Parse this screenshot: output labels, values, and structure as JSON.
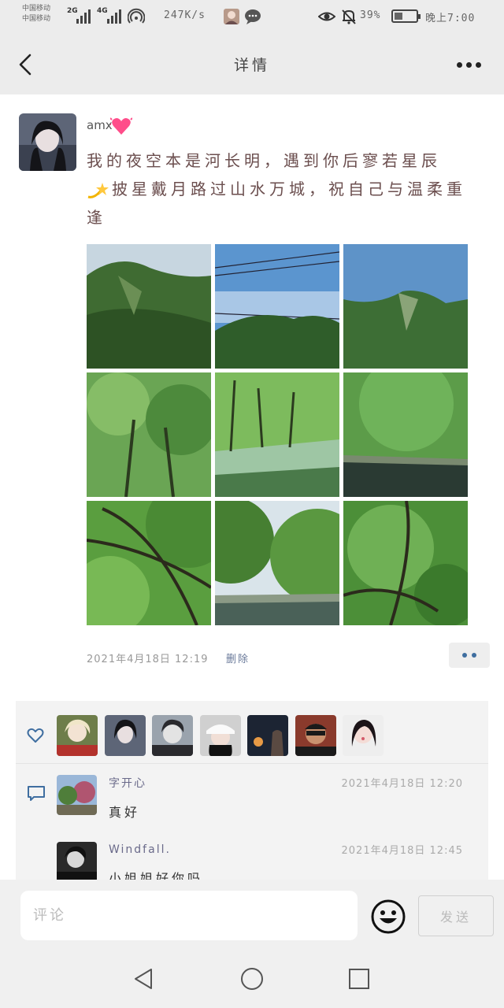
{
  "status_bar": {
    "carrier_1": "中国移动",
    "carrier_2": "中国移动",
    "network_1": "2G",
    "network_2": "4G",
    "speed": "247K/s",
    "battery": "39%",
    "battery_level": 0.39,
    "time": "晚上7:00"
  },
  "header": {
    "title": "详情"
  },
  "post": {
    "username": "amx",
    "text_line1": "我的夜空本是河长明，遇到你后寥若星辰",
    "text_line2": "披星戴月路过山水万城，祝自己与温柔重逢",
    "date": "2021年4月18日 12:19",
    "delete_label": "删除",
    "photos": [
      "mountain-slope",
      "power-lines-sky",
      "mountain-ridge",
      "green-trees",
      "river-trees",
      "lake-trees",
      "tree-canopy",
      "river-bank",
      "leafy-branches"
    ]
  },
  "likes": {
    "avatars": [
      "anime-girl",
      "dark-hair-girl",
      "anime-boy",
      "woman-cap",
      "night-scene",
      "man-glasses",
      "girl-portrait"
    ]
  },
  "comments": [
    {
      "name": "字开心",
      "time": "2021年4月18日 12:20",
      "text": "真好"
    },
    {
      "name": "Windfall.",
      "time": "2021年4月18日 12:45",
      "text": "小姐姐好你吗"
    }
  ],
  "input": {
    "placeholder": "评论",
    "send_label": "发送"
  },
  "colors": {
    "accent": "#3f6ea0",
    "background": "#ececec"
  }
}
